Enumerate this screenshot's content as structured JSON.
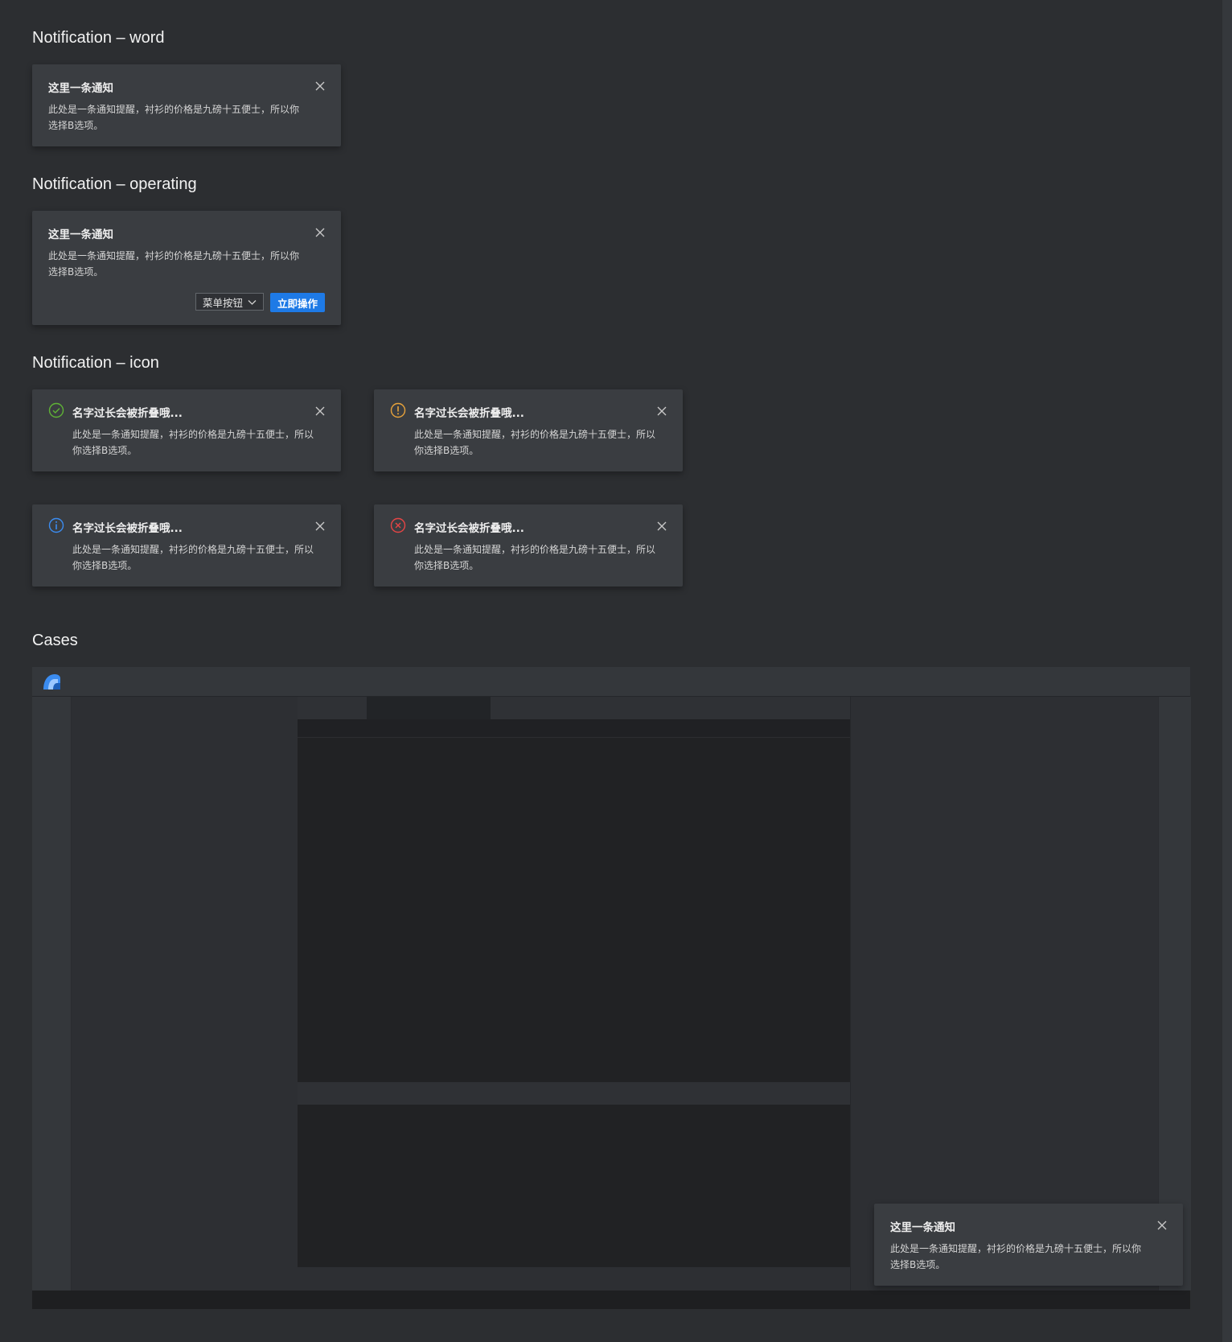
{
  "sections": {
    "word": "Notification – word",
    "operating": "Notification – operating",
    "icon": "Notification – icon",
    "cases": "Cases"
  },
  "notification_word": {
    "title": "这里一条通知",
    "body": "此处是一条通知提醒，衬衫的价格是九磅十五便士，所以你选择B选项。",
    "close_icon": "close-icon"
  },
  "notification_operating": {
    "title": "这里一条通知",
    "body": "此处是一条通知提醒，衬衫的价格是九磅十五便士，所以你选择B选项。",
    "menu_button": "菜单按钮",
    "primary_button": "立即操作",
    "primary_color": "#1e7ae6"
  },
  "notification_icons": [
    {
      "type": "success",
      "icon": "check-circle-icon",
      "color": "#5fb236",
      "title": "名字过长会被折叠哦...",
      "body": "此处是一条通知提醒，衬衫的价格是九磅十五便士，所以你选择B选项。"
    },
    {
      "type": "warning",
      "icon": "exclamation-circle-icon",
      "color": "#e8a33b",
      "title": "名字过长会被折叠哦...",
      "body": "此处是一条通知提醒，衬衫的价格是九磅十五便士，所以你选择B选项。"
    },
    {
      "type": "info",
      "icon": "info-circle-icon",
      "color": "#3b8cf0",
      "title": "名字过长会被折叠哦...",
      "body": "此处是一条通知提醒，衬衫的价格是九磅十五便士，所以你选择B选项。"
    },
    {
      "type": "error",
      "icon": "x-circle-icon",
      "color": "#e54545",
      "title": "名字过长会被折叠哦...",
      "body": "此处是一条通知提醒，衬衫的价格是九磅十五便士，所以你选择B选项。"
    }
  ],
  "case_notification": {
    "title": "这里一条通知",
    "body": "此处是一条通知提醒，衬衫的价格是九磅十五便士，所以你选择B选项。"
  }
}
